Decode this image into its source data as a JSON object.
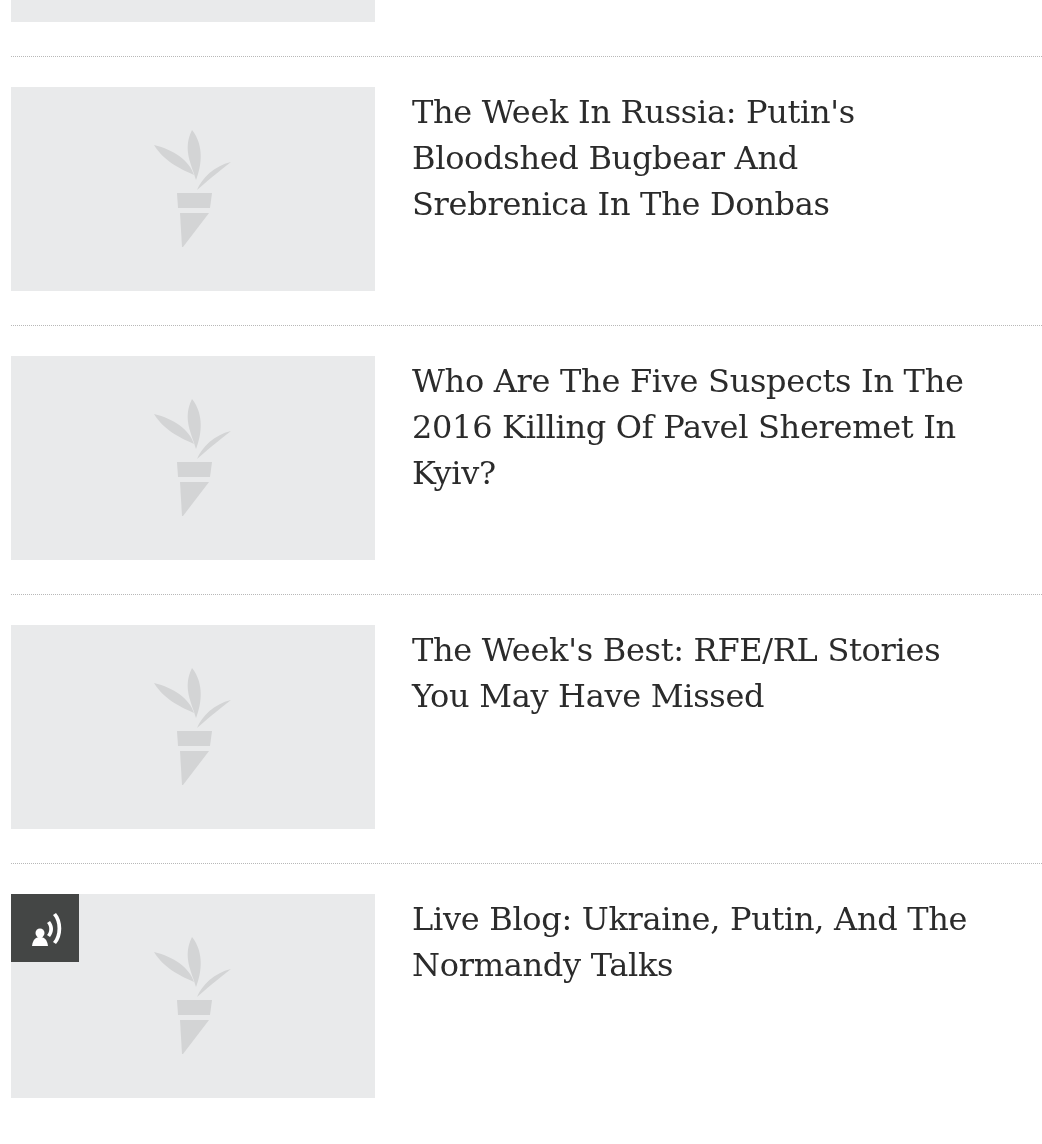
{
  "articles": [
    {
      "title_lines": [
        "The Week In Russia: Putin's",
        "Bloodshed Bugbear And",
        "Srebrenica In The Donbas"
      ],
      "live": false
    },
    {
      "title_lines": [
        "Who Are The Five Suspects In The",
        "2016 Killing Of Pavel Sheremet In",
        "Kyiv?"
      ],
      "live": false
    },
    {
      "title_lines": [
        "The Week's Best: RFE/RL Stories",
        "You May Have Missed"
      ],
      "live": false
    },
    {
      "title_lines": [
        "Live Blog: Ukraine, Putin, And The",
        "Normandy Talks"
      ],
      "live": true
    }
  ]
}
